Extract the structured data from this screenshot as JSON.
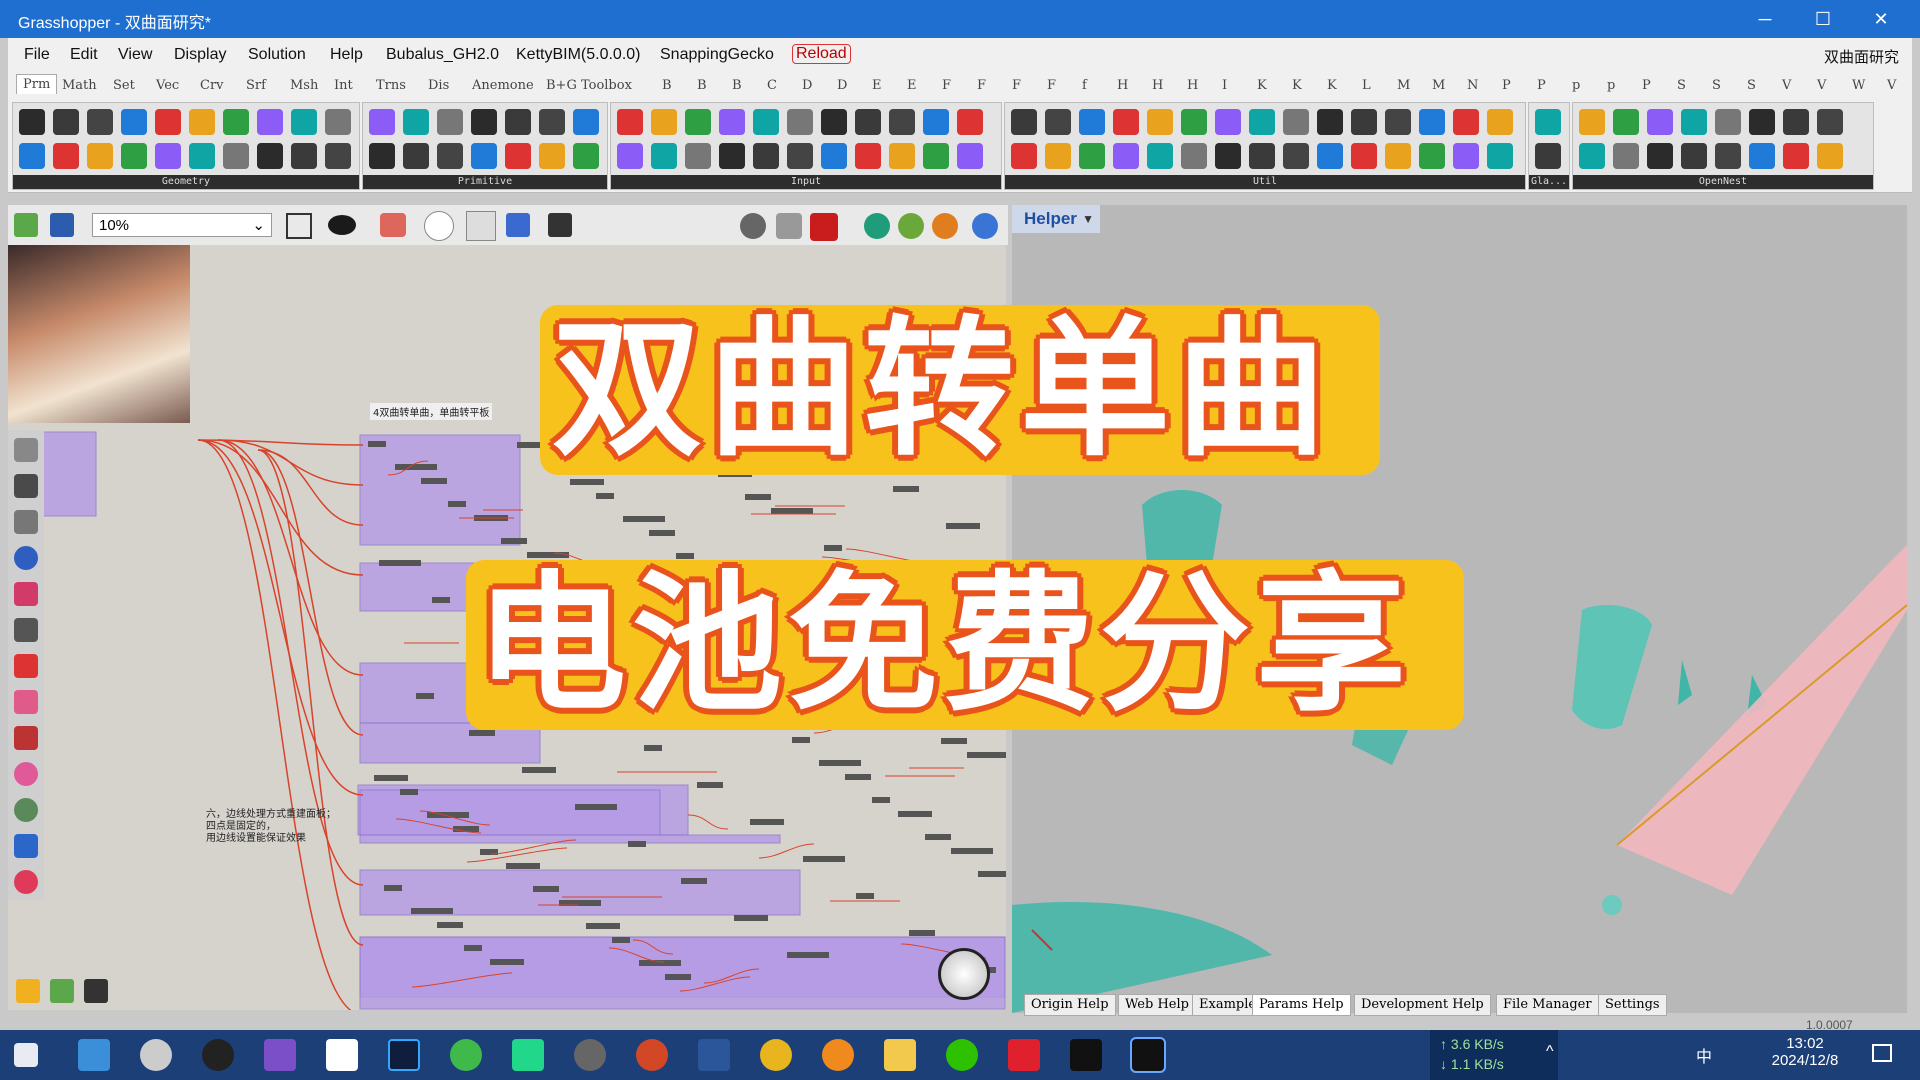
{
  "window": {
    "title": "Grasshopper - 双曲面研究*",
    "right_label": "双曲面研究"
  },
  "window_controls": {
    "minimize": "─",
    "maximize": "☐",
    "close": "✕"
  },
  "menu": [
    "File",
    "Edit",
    "View",
    "Display",
    "Solution",
    "Help",
    "Bubalus_GH2.0",
    "KettyBIM(5.0.0.0)",
    "SnappingGecko",
    "Reload"
  ],
  "tabs": [
    "Prm",
    "Math",
    "Set",
    "Vec",
    "Crv",
    "Srf",
    "Msh",
    "Int",
    "Trns",
    "Dis",
    "Anemone",
    "B+G Toolbox",
    "B",
    "B",
    "B",
    "C",
    "D",
    "D",
    "E",
    "E",
    "F",
    "F",
    "F",
    "F",
    "f",
    "H",
    "H",
    "H",
    "I",
    "K",
    "K",
    "K",
    "L",
    "M",
    "M",
    "N",
    "P",
    "P",
    "p",
    "p",
    "P",
    "S",
    "S",
    "S",
    "V",
    "V",
    "W",
    "V"
  ],
  "ribbon_groups": [
    "Geometry",
    "Primitive",
    "Input",
    "Util",
    "Gla...",
    "OpenNest"
  ],
  "canvas_toolbar": {
    "zoom": "10%"
  },
  "viewport": {
    "helper_label": "Helper"
  },
  "banner": {
    "line1": "双曲转单曲",
    "line2": "电池免费分享"
  },
  "canvas_notes": {
    "group_title": "4双曲转单曲，单曲转平板",
    "note_line1": "六，边线处理方式重建面板；",
    "note_line2": "四点是固定的，",
    "note_line3": "用边线设置能保证效果"
  },
  "help_tabs": [
    "Origin Help",
    "Web Help",
    "Example",
    "Params Help",
    "Development Help",
    "File Manager",
    "Settings"
  ],
  "version": "1.0.0007",
  "taskbar": {
    "upload": "↑ 3.6 KB/s",
    "download": "↓ 1.1 KB/s",
    "time": "13:02",
    "date": "2024/12/8",
    "ime": "中"
  },
  "colors": {
    "titlebar": "#1f6fd0",
    "group_purple": "#b49ae6",
    "wire": "#d8432b",
    "banner": "#f7c21b",
    "banner_outline": "#e8541c",
    "teal": "#3fb6a8"
  }
}
